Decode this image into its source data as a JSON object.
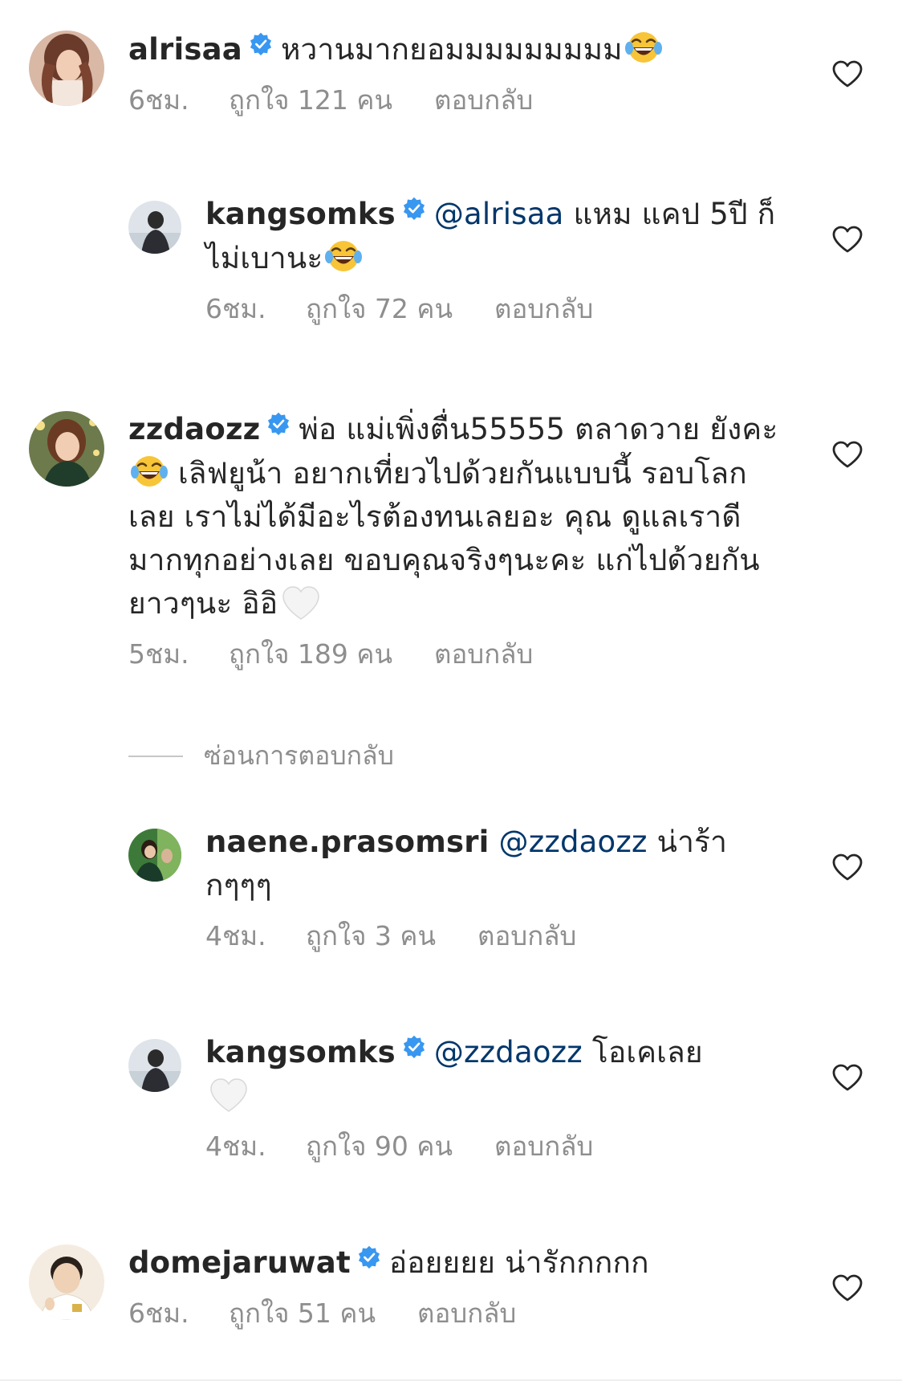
{
  "comments": [
    {
      "username": "alrisaa",
      "mention": "",
      "text": "หวานมากยอมมมมมมมมม",
      "time": "6ชม.",
      "likes": "ถูกใจ 121 คน",
      "reply": "ตอบกลับ",
      "avatar_color": "#8a5a44"
    },
    {
      "username": "kangsomks",
      "mention": "@alrisaa",
      "text": " แหม แคป 5ปี ก็ไม่เบานะ",
      "time": "6ชม.",
      "likes": "ถูกใจ 72 คน",
      "reply": "ตอบกลับ",
      "avatar_color": "#5a6470"
    },
    {
      "username": "zzdaozz",
      "mention": "",
      "text_a": "พ่อ แม่เพิ่งตื่น55555 ตลาดวาย ยังคะ",
      "text_b": " เลิฟยูน้า อยากเที่ยวไปด้วยกันแบบนี้ รอบโลกเลย เราไม่ได้มีอะไรต้องทนเลยอะ คุณ ดูแลเราดีมากทุกอย่างเลย ขอบคุณจริงๆนะคะ แก่ไปด้วยกันยาวๆนะ อิอิ",
      "time": "5ชม.",
      "likes": "ถูกใจ 189 คน",
      "reply": "ตอบกลับ",
      "avatar_color": "#4d6b3a"
    },
    {
      "username": "naene.prasomsri",
      "mention": "@zzdaozz",
      "text": " น่าร้า กๆๆๆ",
      "time": "4ชม.",
      "likes": "ถูกใจ 3 คน",
      "reply": "ตอบกลับ",
      "avatar_color": "#4f8a4a"
    },
    {
      "username": "kangsomks",
      "mention": "@zzdaozz",
      "text": " โอเคเลย",
      "time": "4ชม.",
      "likes": "ถูกใจ 90 คน",
      "reply": "ตอบกลับ",
      "avatar_color": "#5a6470"
    },
    {
      "username": "domejaruwat",
      "mention": "",
      "text": "อ่อยยยย น่ารักกกกก",
      "time": "6ชม.",
      "likes": "ถูกใจ 51 คน",
      "reply": "ตอบกลับ",
      "avatar_color": "#e8d5b8"
    }
  ],
  "hide_replies": "ซ่อนการตอบกลับ",
  "colors": {
    "verified": "#3897f0",
    "mention": "#00376b",
    "meta": "#8e8e8e",
    "text": "#262626"
  }
}
